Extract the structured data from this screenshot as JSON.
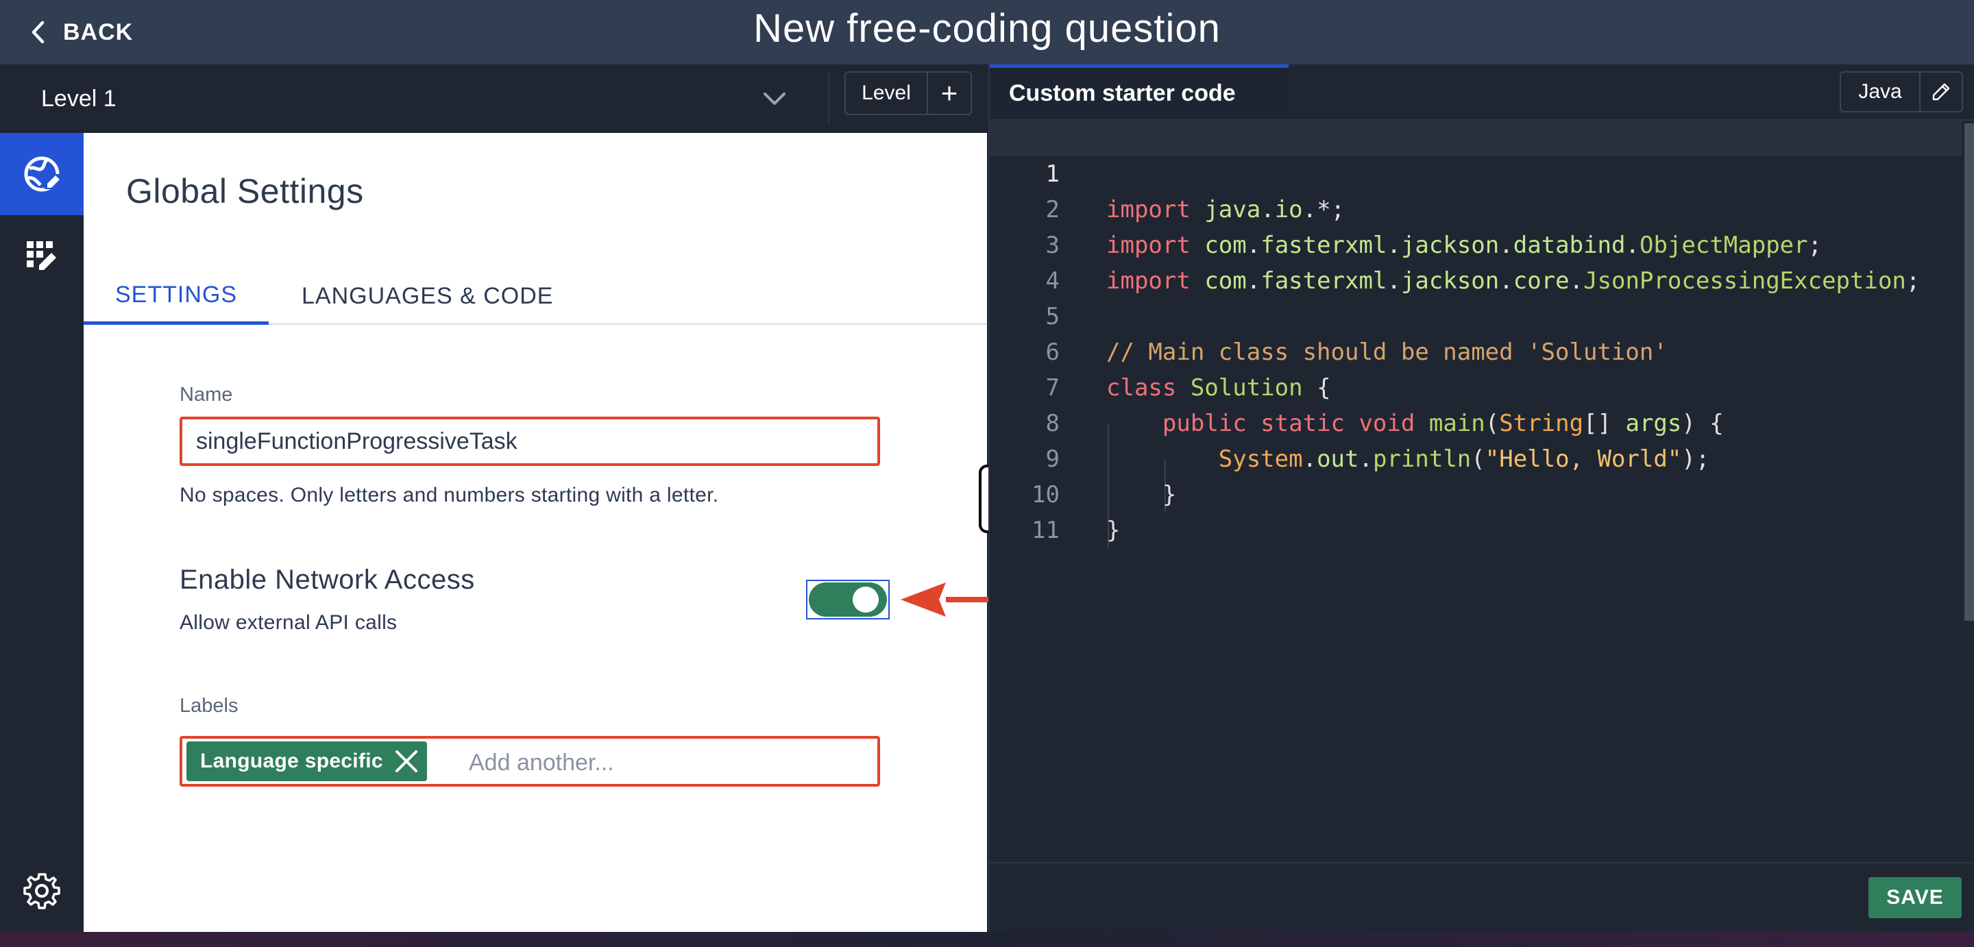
{
  "header": {
    "back_label": "BACK",
    "title": "New free-coding question"
  },
  "level_bar": {
    "selected_level": "Level 1",
    "level_button_label": "Level",
    "add_symbol": "+"
  },
  "rail": {
    "items": [
      "global-settings-icon",
      "grid-edit-icon"
    ],
    "bottom_item": "gear-icon",
    "active_color": "#2453d6"
  },
  "settings": {
    "title": "Global Settings",
    "tabs": [
      {
        "label": "SETTINGS",
        "active": true
      },
      {
        "label": "LANGUAGES & CODE",
        "active": false
      }
    ],
    "name_label": "Name",
    "name_value": "singleFunctionProgressiveTask",
    "name_helper": "No spaces. Only letters and numbers starting with a letter.",
    "network_title": "Enable Network Access",
    "network_subtitle": "Allow external API calls",
    "network_enabled": true,
    "labels_label": "Labels",
    "label_chips": [
      "Language specific"
    ],
    "labels_placeholder": "Add another..."
  },
  "editor": {
    "tab_title": "Custom starter code",
    "language": "Java",
    "current_line": 1,
    "line_numbers": [
      "1",
      "2",
      "3",
      "4",
      "5",
      "6",
      "7",
      "8",
      "9",
      "10",
      "11"
    ],
    "save_label": "SAVE",
    "code": {
      "l1": {
        "kw": "import",
        "pkg": "java",
        "d1": ".",
        "pkg2": "io",
        "d2": ".",
        "rest": "*;"
      },
      "l2": {
        "kw": "import",
        "a": "com",
        "d1": ".",
        "b": "fasterxml",
        "d2": ".",
        "c": "jackson",
        "d3": ".",
        "d": "databind",
        "d4": ".",
        "cls": "ObjectMapper",
        "end": ";"
      },
      "l3": {
        "kw": "import",
        "a": "com",
        "d1": ".",
        "b": "fasterxml",
        "d2": ".",
        "c": "jackson",
        "d3": ".",
        "d": "core",
        "d4": ".",
        "cls": "JsonProcessingException",
        "end": ";"
      },
      "l5": {
        "comment": "// Main class should be named 'Solution'"
      },
      "l6": {
        "kw": "class",
        "name": "Solution",
        "rest": " {"
      },
      "l7": {
        "kw": "public static void",
        "fn": "main",
        "p1": "(",
        "ty": "String",
        "p2": "[] ",
        "arg": "args",
        "p3": ") {"
      },
      "l8": {
        "obj": "System",
        "d1": ".",
        "field": "out",
        "d2": ".",
        "fn": "println",
        "p1": "(",
        "str": "\"Hello, World\"",
        "p2": ");"
      },
      "l9": {
        "text": "}"
      },
      "l10": {
        "text": "}"
      }
    }
  },
  "colors": {
    "accent_green": "#2f7e5c",
    "accent_blue": "#2453d6",
    "error_red": "#e0442b"
  }
}
